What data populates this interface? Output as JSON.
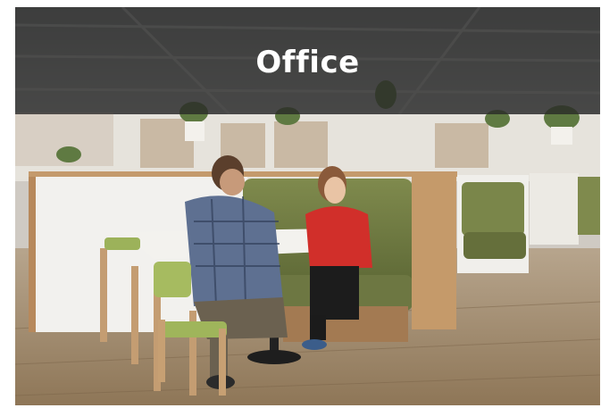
{
  "card": {
    "title": "Office",
    "image_subject": "office-meeting-booth-photo"
  },
  "colors": {
    "overlay": "#262626",
    "title_text": "#ffffff"
  }
}
